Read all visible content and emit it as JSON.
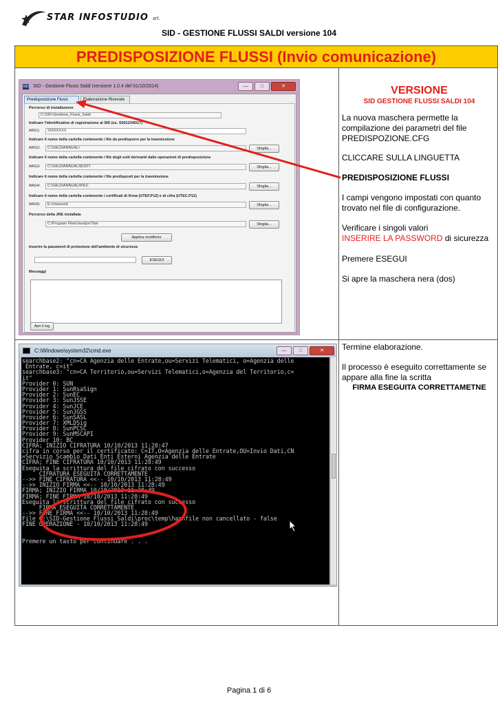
{
  "header": {
    "logo_text": "STAR INFOSTUDIO",
    "logo_suffix": "srl.",
    "doc_title": "SID - GESTIONE FLUSSI SALDI versione 104"
  },
  "banner": "PREDISPOSIZIONE FLUSSI (Invio comunicazione)",
  "sid_window": {
    "title": "SID - Gestione Flussi Saldi (versione 1.0.4 del 01/10/2014)",
    "icon": "SID",
    "tabs": [
      "Predisposizione Flussi",
      "Elaborazione Ricevute"
    ],
    "percorso_label": "Percorso di installazione",
    "percorso_value": "C:\\SID-Gestione_Flussi_Saldi",
    "id_label": "Indicare l'identificativo di registrazione al SID (es. S0012345G7)",
    "arg1_label": "ARG1:",
    "arg1_value": "S000XXXX",
    "arg2_desc": "Indicare il nome della cartella contenente i file da predisporre per la trasmissione",
    "arg2_label": "ARG2:",
    "arg2_value": "C:\\SALDIANNUALI",
    "arg3_desc": "Indicare il nome della cartella contenente i file degli esiti derivanti dalle operazioni di predisposizione",
    "arg3_label": "ARG3:",
    "arg3_value": "C:\\SALDIANNUALI\\ESITI",
    "arg4_desc": "Indicare il nome della cartella contenente i file predisposti per la trasmissione",
    "arg4_label": "ARG4:",
    "arg4_value": "C:\\SALDIANNUALI\\PEC",
    "arg5_desc": "Indicare il nome della cartella contenente i certificati di firma (UTEF.P12) e di cifra (UTEC.P12)",
    "arg5_label": "ARG5:",
    "arg5_value": "E:\\chiavesid",
    "jre_label": "Percorso della JRE installata",
    "jre_value": "C:\\Program Files\\Java\\jre7\\bin",
    "browse_label": "Sfoglia...",
    "apply_label": "Applica modifiche",
    "password_label": "Inserire la password di protezione dell'ambiente di sicurezza",
    "esegui_label": "ESEGUI",
    "messaggi_label": "Messaggi",
    "log_label": "Apri il log"
  },
  "right_top": {
    "versione_heading": "VERSIONE",
    "versione_sub": "SID GESTIONE FLUSSI SALDI 104",
    "p1": "La nuova maschera permette la compilazione dei parametri del file PREDISPOZIONE.CFG",
    "p2": "CLICCARE SULLA LINGUETTA",
    "p3": "PREDISPOSIZIONE FLUSSI",
    "p4": "I campi vengono impostati con quanto trovato nel file di configurazione.",
    "p5a": "Verificare i singoli valori",
    "p5b": "INSERIRE LA PASSWORD",
    "p5c": " di sicurezza",
    "p6": "Premere ESEGUI",
    "p7": "Si apre la maschera nera (dos)"
  },
  "cmd_window": {
    "title": "C:\\Windows\\system32\\cmd.exe",
    "lines": [
      "searchbase2: \"cn=CA Agenzia delle Entrate,ou=Servizi Telematici, o=Agenzia delle",
      " Entrate, c=it\"",
      "searchbase3: \"cn=CA Territorio,ou=Servizi Telematici,o=Agenzia del Territorio,c=",
      "it\"",
      "Provider 0: SUN",
      "Provider 1: SunRsaSign",
      "Provider 2: SunEC",
      "Provider 3: SunJSSE",
      "Provider 4: SunJCE",
      "Provider 5: SunJGSS",
      "Provider 6: SunSASL",
      "Provider 7: XMLDSig",
      "Provider 8: SunPCSC",
      "Provider 9: SunMSCAPI",
      "Provider 10: BC",
      "CIFRA; INIZIO CIFRATURA 10/10/2013 11:28:47",
      "cifra in corso per il certificato: C=IT,O=Agenzia delle Entrate,OU=Invio Dati,CN",
      "=Servizio Scambio Dati Enti Esterni Agenzia delle Entrate",
      "CIFRA; FINE CIFRATURA 10/10/2013 11:28:49",
      "Eseguita la scrittura del file cifrato con successo",
      "     CIFRATURA ESEGUITA CORRETTAMENTE",
      "-->> FINE CIFRATURA <<-- 10/10/2013 11:28:49",
      "-->> INIZIO FIRMA <<-- 10/10/2013 11:28:49",
      "FIRMA; INIZIO FIRMA 10/10/2013 11:28:49",
      "FIRMA; FINE FIRMA 10/10/2013 11:28:49",
      "Eseguita la scrittura del file cifrato con successo",
      "     FIRMA ESEGUITA CORRETTAMENTE",
      "-->> FINE FIRMA <<-- 10/10/2013 11:28:49",
      "File C:\\SID-Gestione_Flussi_Saldi\\proc\\temp\\hashfile non cancellato - false",
      "FINE OPERAZIONE - 10/10/2013 11:28:49",
      "",
      "",
      "Premere un tasto per continuare . . ."
    ]
  },
  "right_bottom": {
    "p1": "Termine elaborazione.",
    "p2": "Il processo è eseguito correttamente se appare alla fine la scritta",
    "p3": "FIRMA ESEGUITA CORRETTAMETNE"
  },
  "footer": "Pagina 1 di 6",
  "colors": {
    "banner_bg": "#ffcc00",
    "accent_red": "#e0201b"
  }
}
